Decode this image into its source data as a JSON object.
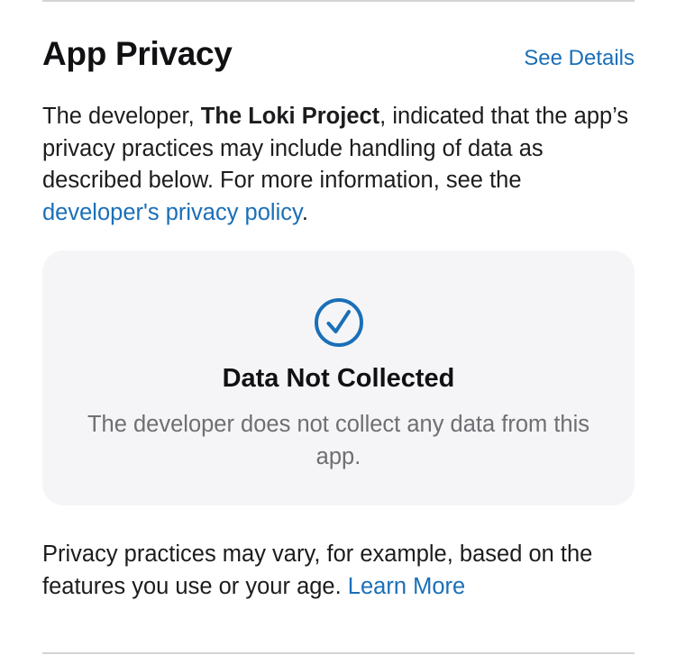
{
  "section": {
    "title": "App Privacy",
    "see_details": "See Details"
  },
  "intro": {
    "prefix": "The developer, ",
    "developer_name": "The Loki Project",
    "middle": ", indicated that the app’s privacy practices may include handling of data as described below. For more information, see the ",
    "policy_link": "developer's privacy policy",
    "suffix": "."
  },
  "card": {
    "icon": "checkmark-circle-icon",
    "title": "Data Not Collected",
    "description": "The developer does not collect any data from this app."
  },
  "footer": {
    "text": "Privacy practices may vary, for example, based on the features you use or your age. ",
    "learn_more": "Learn More"
  },
  "colors": {
    "accent": "#1a6fb8",
    "card_background": "#f5f5f7",
    "secondary_text": "#6e6e73"
  }
}
